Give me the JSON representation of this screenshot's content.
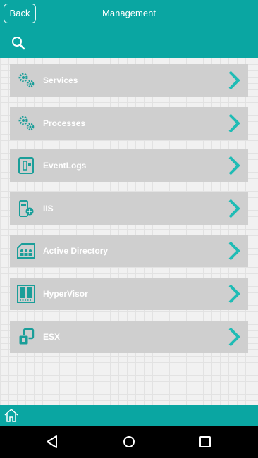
{
  "header": {
    "back_label": "Back",
    "title": "Management",
    "search_icon": "search-icon"
  },
  "menu": {
    "items": [
      {
        "label": "Services",
        "icon": "gears-icon"
      },
      {
        "label": "Processes",
        "icon": "gears-icon"
      },
      {
        "label": "EventLogs",
        "icon": "eventlog-icon"
      },
      {
        "label": "IIS",
        "icon": "iis-server-icon"
      },
      {
        "label": "Active Directory",
        "icon": "active-directory-icon"
      },
      {
        "label": "HyperVisor",
        "icon": "hypervisor-icon"
      },
      {
        "label": "ESX",
        "icon": "esx-icon"
      }
    ]
  },
  "footer": {
    "home_icon": "home-icon"
  },
  "android_nav": {
    "back": "back-triangle-icon",
    "home": "home-circle-icon",
    "recents": "recents-square-icon"
  },
  "colors": {
    "accent": "#0aa6a2",
    "item_bg": "#cfcfcf",
    "chevron": "#1fbcb5"
  }
}
